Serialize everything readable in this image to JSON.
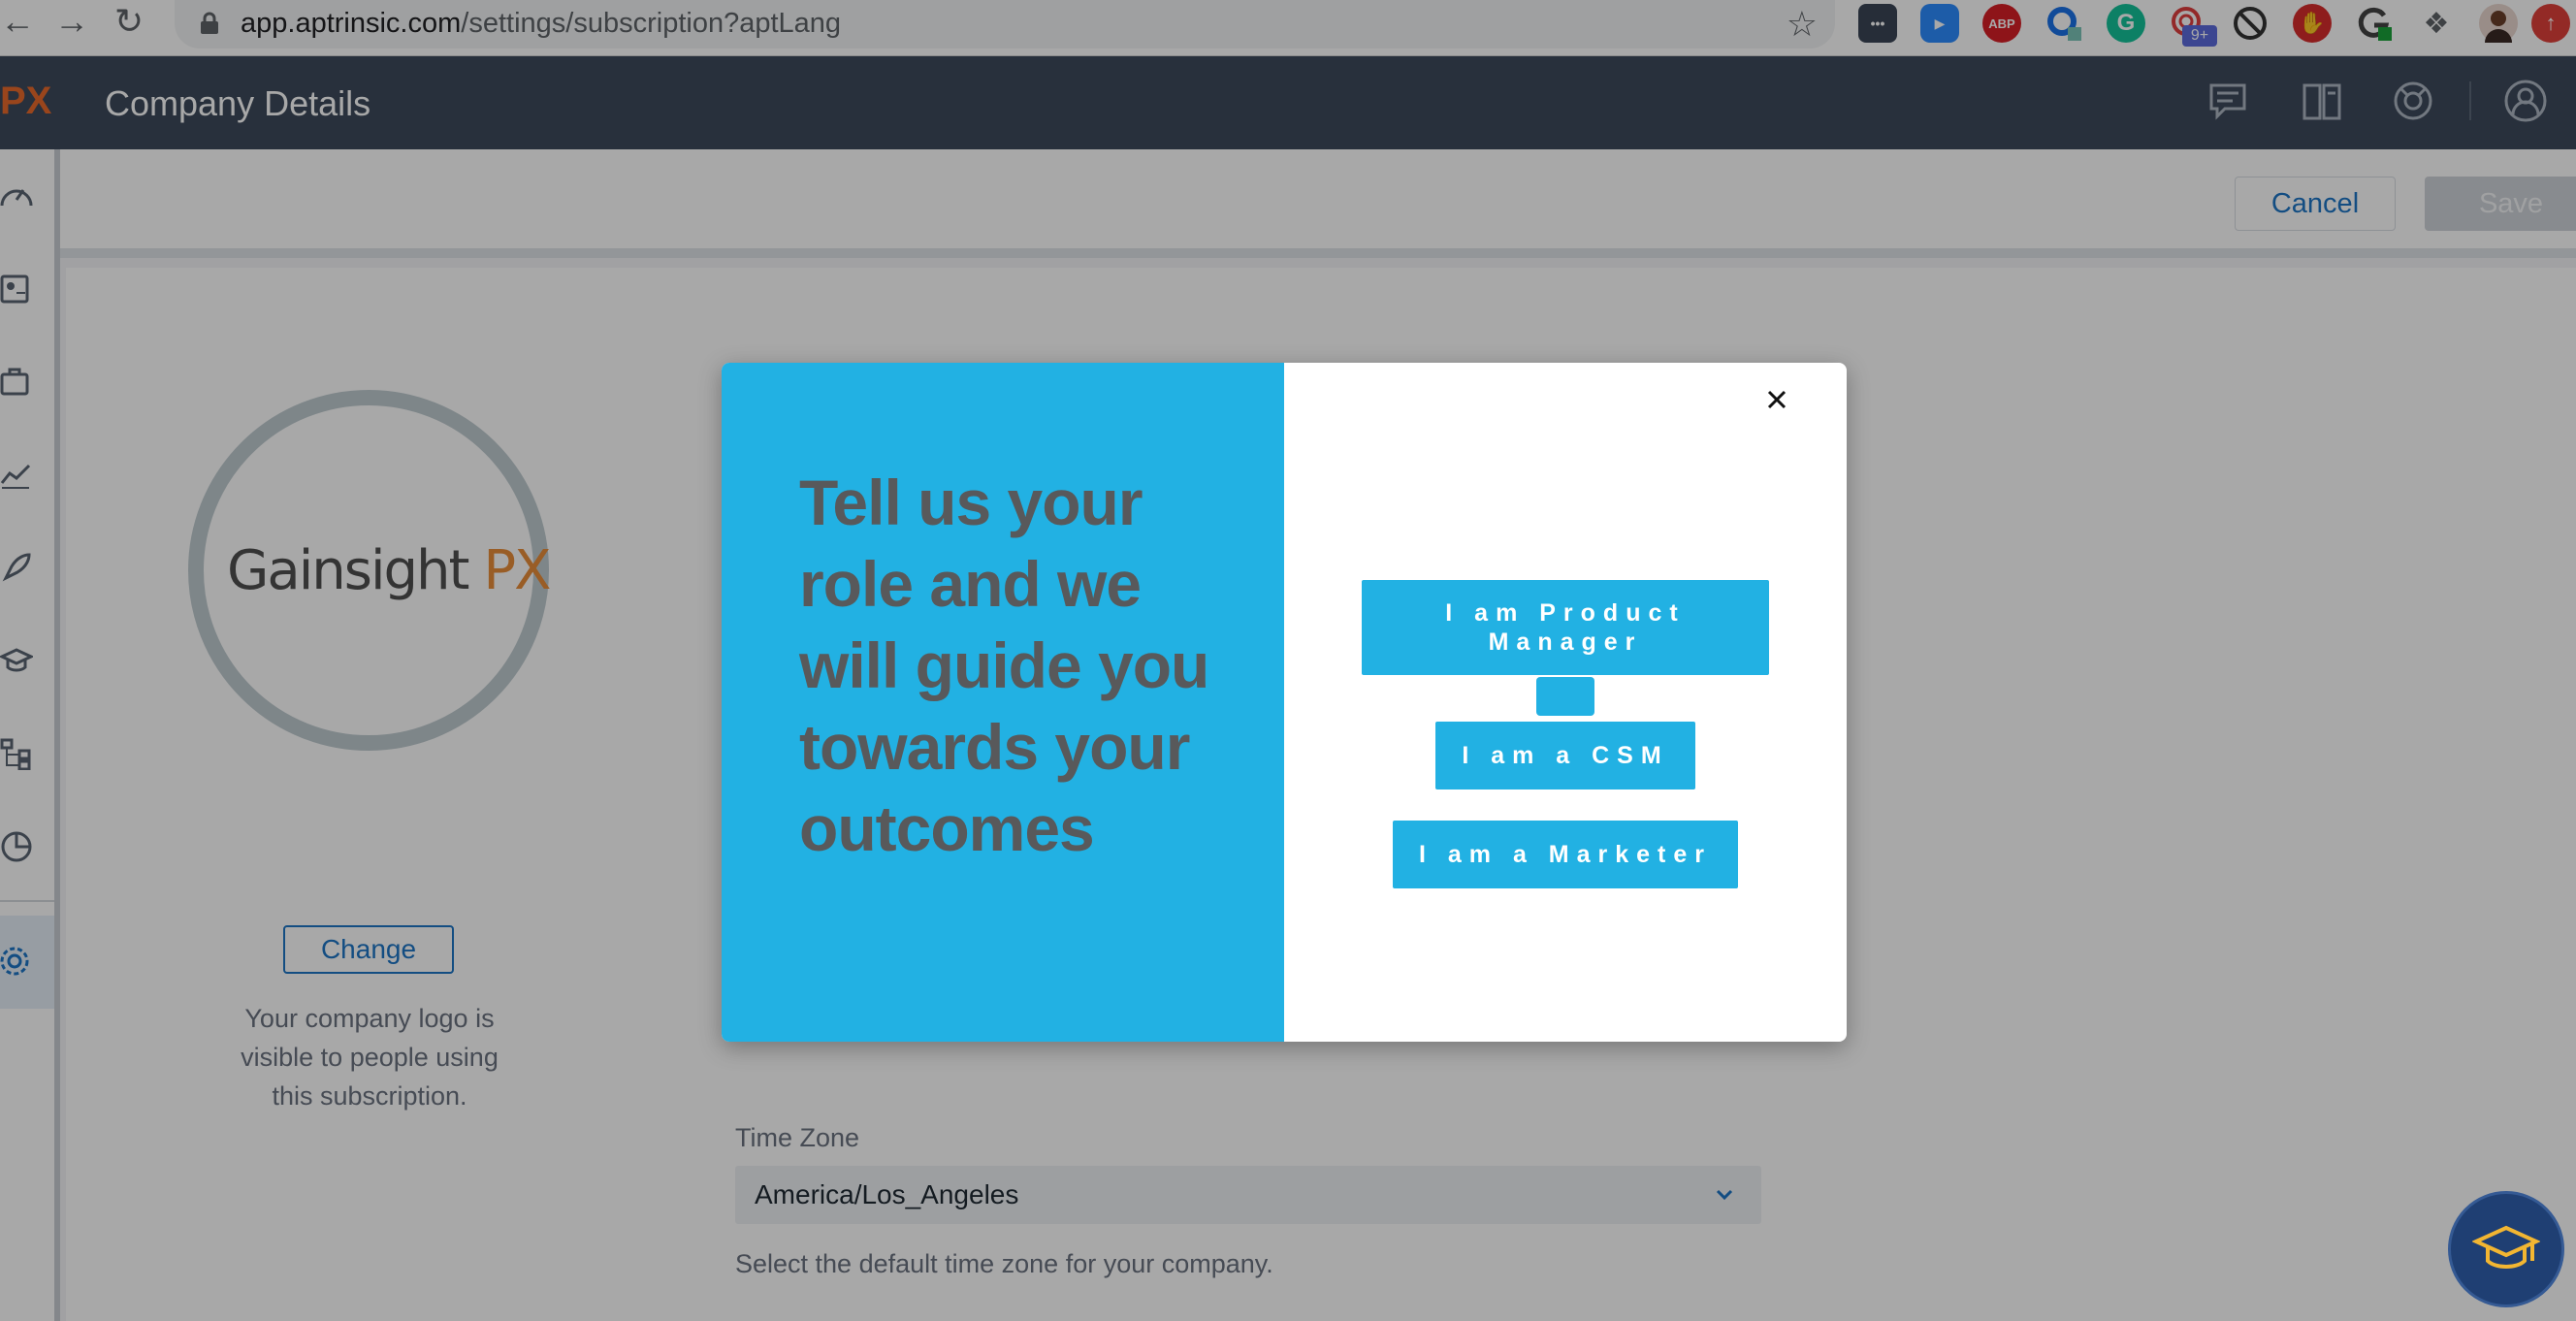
{
  "browser": {
    "url_domain": "app.aptrinsic.com",
    "url_path": "/settings/subscription?aptLang",
    "extension_badge": "9+",
    "abp_label": "ABP"
  },
  "header": {
    "app_title": "Company Details",
    "corner_logo": "PX"
  },
  "actions": {
    "cancel_label": "Cancel",
    "save_label": "Save"
  },
  "company_logo": {
    "logo_word": "Gainsight",
    "logo_px": "PX",
    "change_label": "Change",
    "help_text": "Your company logo is visible to people using this subscription."
  },
  "timezone": {
    "label": "Time Zone",
    "value": "America/Los_Angeles",
    "help_text": "Select the default time zone for your company."
  },
  "modal": {
    "headline": "Tell us your role and we will guide you towards your outcomes",
    "roles": {
      "product_manager": "I am Product Manager",
      "csm": "I am a CSM",
      "marketer": "I am a Marketer"
    }
  },
  "colors": {
    "accent_blue": "#22b1e3",
    "header_bg": "#3d4a5c",
    "link_blue": "#1e76c6"
  }
}
